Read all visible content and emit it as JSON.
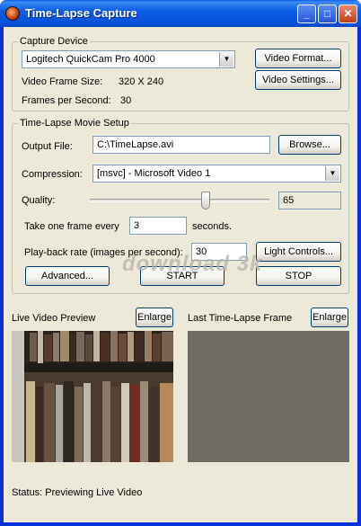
{
  "window": {
    "title": "Time-Lapse Capture",
    "minimize_glyph": "_",
    "maximize_glyph": "□",
    "close_glyph": "✕"
  },
  "capture_device": {
    "group_label": "Capture Device",
    "device_selected": "Logitech QuickCam Pro 4000",
    "video_format_button": "Video Format...",
    "video_settings_button": "Video Settings...",
    "frame_size_label": "Video Frame Size:",
    "frame_size_value": "320 X 240",
    "fps_label": "Frames per Second:",
    "fps_value": "30"
  },
  "movie_setup": {
    "group_label": "Time-Lapse Movie Setup",
    "output_file_label": "Output File:",
    "output_file_value": "C:\\TimeLapse.avi",
    "browse_button": "Browse...",
    "compression_label": "Compression:",
    "compression_value": "[msvc] - Microsoft Video 1",
    "quality_label": "Quality:",
    "quality_value": "65",
    "quality_level_fraction": 0.65,
    "take_frame_label": "Take one frame every",
    "take_frame_value": "3",
    "seconds_label": "seconds.",
    "playback_label": "Play-back rate (images per second):",
    "playback_value": "30",
    "light_controls_button": "Light Controls...",
    "advanced_button": "Advanced...",
    "start_button": "START",
    "stop_button": "STOP"
  },
  "preview": {
    "live_label": "Live Video Preview",
    "live_enlarge_button": "Enlarge",
    "last_label": "Last Time-Lapse Frame",
    "last_enlarge_button": "Enlarge",
    "last_frame_color": "#706b63"
  },
  "status": {
    "text": "Status:  Previewing Live Video"
  },
  "watermark": {
    "text": "download 3k"
  }
}
